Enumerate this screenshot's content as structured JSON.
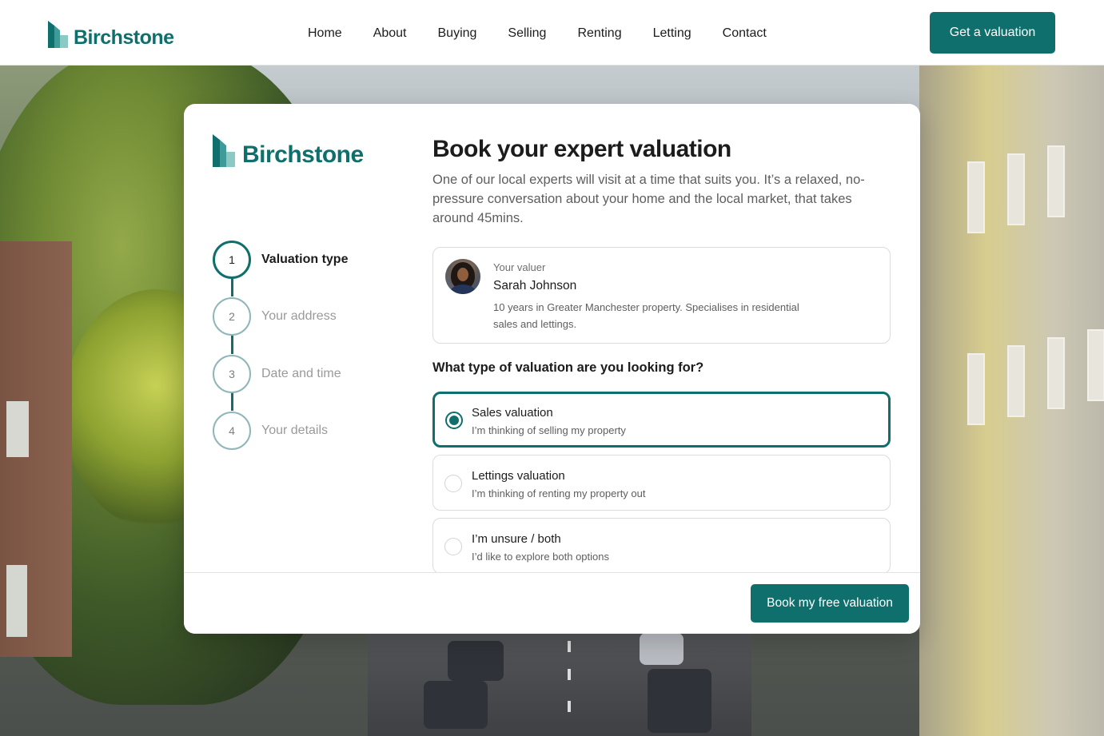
{
  "brand": {
    "name": "Birchstone",
    "color": "#0e6f6c"
  },
  "nav": {
    "items": [
      "Home",
      "About",
      "Buying",
      "Selling",
      "Renting",
      "Letting",
      "Contact"
    ]
  },
  "header_cta": "Get a valuation",
  "modal": {
    "title": "Book your expert valuation",
    "intro": "One of our local experts will visit at a time that suits you. It’s a relaxed, no-pressure conversation about your home and the local market, that takes around 45mins.",
    "steps": [
      {
        "number": "1",
        "label": "Valuation type",
        "state": "active"
      },
      {
        "number": "2",
        "label": "Your address",
        "state": "upcoming"
      },
      {
        "number": "3",
        "label": "Date and time",
        "state": "upcoming"
      },
      {
        "number": "4",
        "label": "Your details",
        "state": "upcoming"
      }
    ],
    "valuer": {
      "kicker": "Your valuer",
      "name": "Sarah Johnson",
      "bio": "10 years in Greater Manchester property. Specialises in residential sales and lettings."
    },
    "question": "What type of valuation are you looking for?",
    "options": [
      {
        "title": "Sales valuation",
        "subtitle": "I’m thinking of selling my property",
        "selected": true
      },
      {
        "title": "Lettings valuation",
        "subtitle": "I’m thinking of renting my property out",
        "selected": false
      },
      {
        "title": "I’m unsure / both",
        "subtitle": "I’d like to explore both options",
        "selected": false
      }
    ],
    "submit_label": "Book my free valuation"
  }
}
